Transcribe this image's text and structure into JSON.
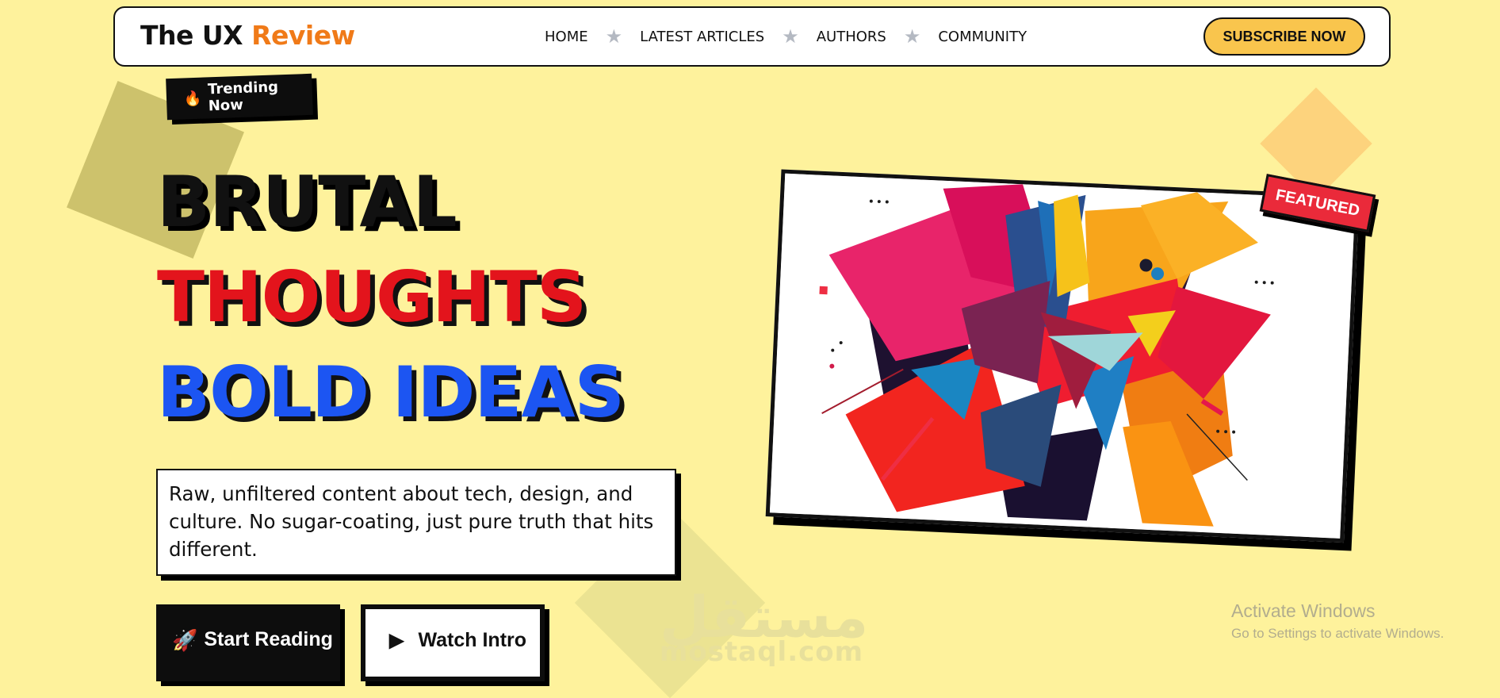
{
  "logo": {
    "part1": "The UX ",
    "part2": "Review"
  },
  "nav": {
    "items": [
      {
        "label": "HOME"
      },
      {
        "label": "LATEST ARTICLES"
      },
      {
        "label": "AUTHORS"
      },
      {
        "label": "COMMUNITY"
      }
    ],
    "separator_icon": "star-icon"
  },
  "subscribe_label": "SUBSCRIBE NOW",
  "trending": {
    "icon": "flame-icon",
    "label": "Trending Now"
  },
  "hero": {
    "line1": "BRUTAL",
    "line2": "THOUGHTS",
    "line3": "BOLD IDEAS",
    "description": "Raw, unfiltered content about tech, design, and culture. No sugar-coating, just pure truth that hits different."
  },
  "buttons": {
    "start": {
      "icon": "rocket-icon",
      "label": "Start Reading"
    },
    "watch": {
      "icon": "play-icon",
      "label": "Watch Intro"
    }
  },
  "featured": {
    "label": "FEATURED"
  },
  "watermark": {
    "arabic": "مستقل",
    "latin": "mostaql.com"
  },
  "os_notice": {
    "title": "Activate Windows",
    "subtitle": "Go to Settings to activate Windows."
  },
  "colors": {
    "background": "#fef29c",
    "accent_orange": "#f07a18",
    "red": "#e3141c",
    "blue": "#1c55f2",
    "subscribe": "#f9c54d",
    "featured": "#ea2a3a"
  }
}
